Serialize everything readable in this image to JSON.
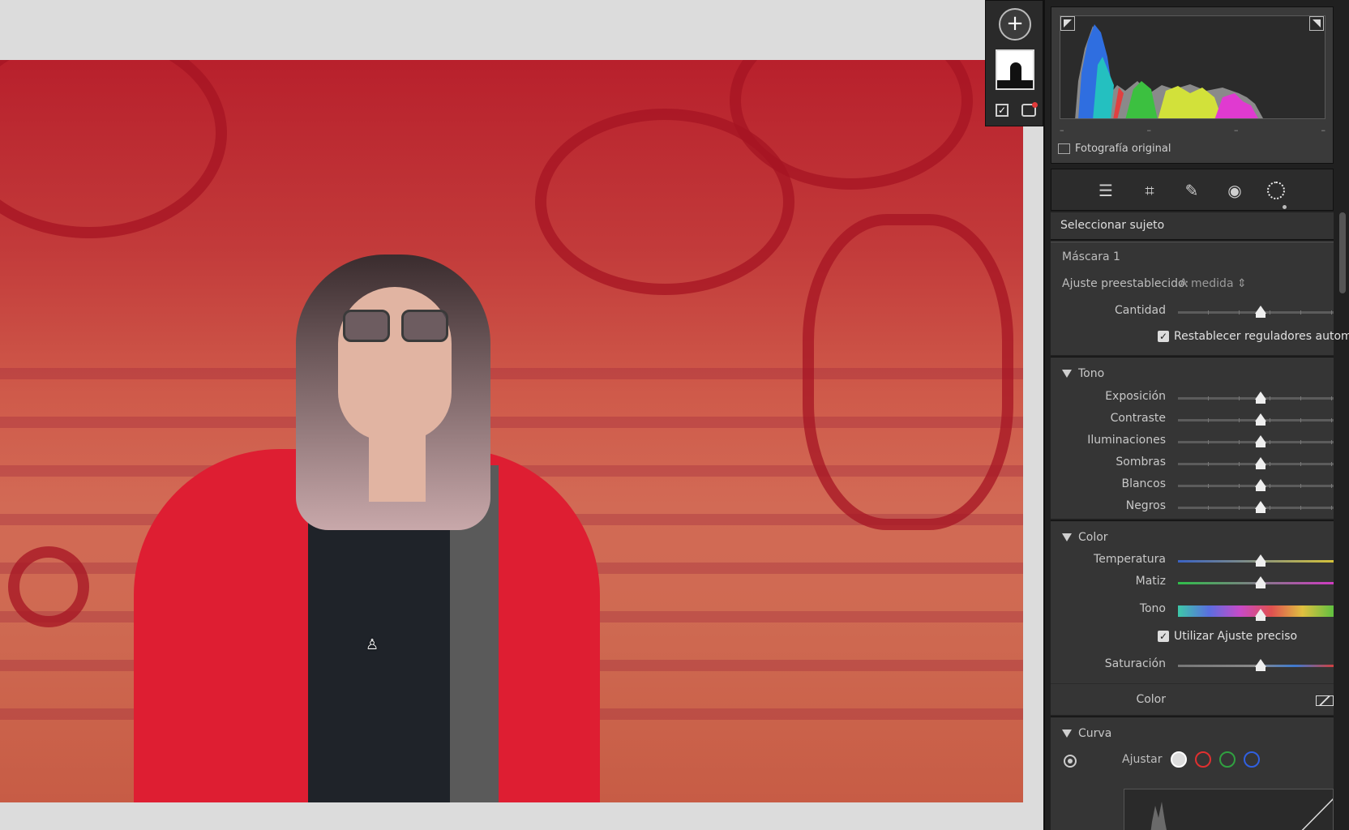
{
  "histogram": {
    "original_photo_label": "Fotografía original",
    "dash_labels": [
      "–",
      "–",
      "–",
      "–"
    ]
  },
  "tools": {
    "items": [
      "edit-sliders",
      "crop",
      "healing",
      "red-eye",
      "masking"
    ],
    "active": "masking"
  },
  "mask_toolbar": {
    "add_label": "+"
  },
  "panel": {
    "select_subject": "Seleccionar sujeto",
    "mask_name": "Máscara 1",
    "preset_label": "Ajuste preestablecido:",
    "preset_value": "A medida",
    "amount_label": "Cantidad",
    "amount_value": 0.53,
    "auto_reset_label": "Restablecer reguladores autom.",
    "auto_reset_checked": true
  },
  "tone": {
    "title": "Tono",
    "sliders": [
      {
        "label": "Exposición",
        "value": 0.53
      },
      {
        "label": "Contraste",
        "value": 0.53
      },
      {
        "label": "Iluminaciones",
        "value": 0.53
      },
      {
        "label": "Sombras",
        "value": 0.53
      },
      {
        "label": "Blancos",
        "value": 0.53
      },
      {
        "label": "Negros",
        "value": 0.53
      }
    ]
  },
  "color": {
    "title": "Color",
    "temperature_label": "Temperatura",
    "tint_label": "Matiz",
    "hue_label": "Tono",
    "fine_adjust_label": "Utilizar Ajuste preciso",
    "fine_adjust_checked": true,
    "saturation_label": "Saturación",
    "color_label": "Color",
    "values": {
      "temperature": 0.53,
      "tint": 0.53,
      "hue": 0.53,
      "saturation": 0.53
    }
  },
  "curve": {
    "title": "Curva",
    "adjust_label": "Ajustar",
    "channels": [
      {
        "name": "rgb",
        "color": "#ffffff"
      },
      {
        "name": "red",
        "color": "#e03030"
      },
      {
        "name": "green",
        "color": "#30a040"
      },
      {
        "name": "blue",
        "color": "#3060e0"
      }
    ]
  },
  "colors": {
    "panel_bg": "#353535",
    "mask_overlay": "#b8202c",
    "jacket": "#de1e32"
  }
}
